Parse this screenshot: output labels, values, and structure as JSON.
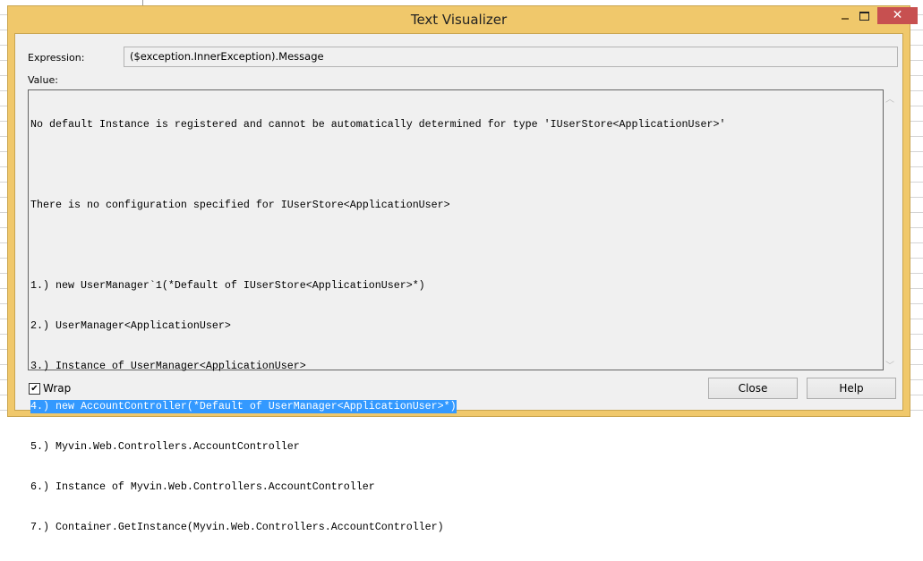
{
  "window": {
    "title": "Text Visualizer"
  },
  "expression": {
    "label": "Expression:",
    "value": "($exception.InnerException).Message"
  },
  "value": {
    "label": "Value:",
    "lines": [
      "No default Instance is registered and cannot be automatically determined for type 'IUserStore<ApplicationUser>'",
      "",
      "There is no configuration specified for IUserStore<ApplicationUser>",
      "",
      "1.) new UserManager`1(*Default of IUserStore<ApplicationUser>*)",
      "2.) UserManager<ApplicationUser>",
      "3.) Instance of UserManager<ApplicationUser>",
      "4.) new AccountController(*Default of UserManager<ApplicationUser>*)",
      "5.) Myvin.Web.Controllers.AccountController",
      "6.) Instance of Myvin.Web.Controllers.AccountController",
      "7.) Container.GetInstance(Myvin.Web.Controllers.AccountController)"
    ],
    "selected_line": "4.) new AccountController(*Default of UserManager<ApplicationUser>*)"
  },
  "wrap": {
    "label": "Wrap",
    "checked": true
  },
  "buttons": {
    "close": "Close",
    "help": "Help"
  },
  "colors": {
    "frame": "#f0c86b",
    "close_button": "#c75050",
    "selection": "#3399ff"
  }
}
